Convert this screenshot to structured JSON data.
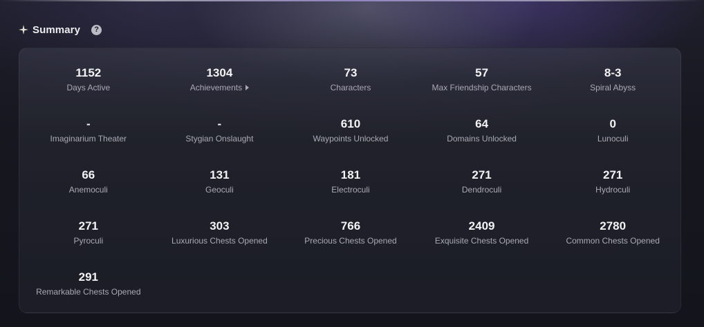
{
  "header": {
    "title": "Summary",
    "help_glyph": "?",
    "icons": {
      "title": "sparkle-icon",
      "help": "help-icon"
    }
  },
  "colors": {
    "background": "#15161e",
    "panel": "#262834",
    "value_text": "#f3f3f6",
    "label_text": "#a9aab5"
  },
  "stats": [
    {
      "value": "1152",
      "label": "Days Active"
    },
    {
      "value": "1304",
      "label": "Achievements",
      "icon": "caret-right-icon"
    },
    {
      "value": "73",
      "label": "Characters"
    },
    {
      "value": "57",
      "label": "Max Friendship Characters"
    },
    {
      "value": "8-3",
      "label": "Spiral Abyss"
    },
    {
      "value": "-",
      "label": "Imaginarium Theater"
    },
    {
      "value": "-",
      "label": "Stygian Onslaught"
    },
    {
      "value": "610",
      "label": "Waypoints Unlocked"
    },
    {
      "value": "64",
      "label": "Domains Unlocked"
    },
    {
      "value": "0",
      "label": "Lunoculi"
    },
    {
      "value": "66",
      "label": "Anemoculi"
    },
    {
      "value": "131",
      "label": "Geoculi"
    },
    {
      "value": "181",
      "label": "Electroculi"
    },
    {
      "value": "271",
      "label": "Dendroculi"
    },
    {
      "value": "271",
      "label": "Hydroculi"
    },
    {
      "value": "271",
      "label": "Pyroculi"
    },
    {
      "value": "303",
      "label": "Luxurious Chests Opened"
    },
    {
      "value": "766",
      "label": "Precious Chests Opened"
    },
    {
      "value": "2409",
      "label": "Exquisite Chests Opened"
    },
    {
      "value": "2780",
      "label": "Common Chests Opened"
    },
    {
      "value": "291",
      "label": "Remarkable Chests Opened"
    }
  ]
}
